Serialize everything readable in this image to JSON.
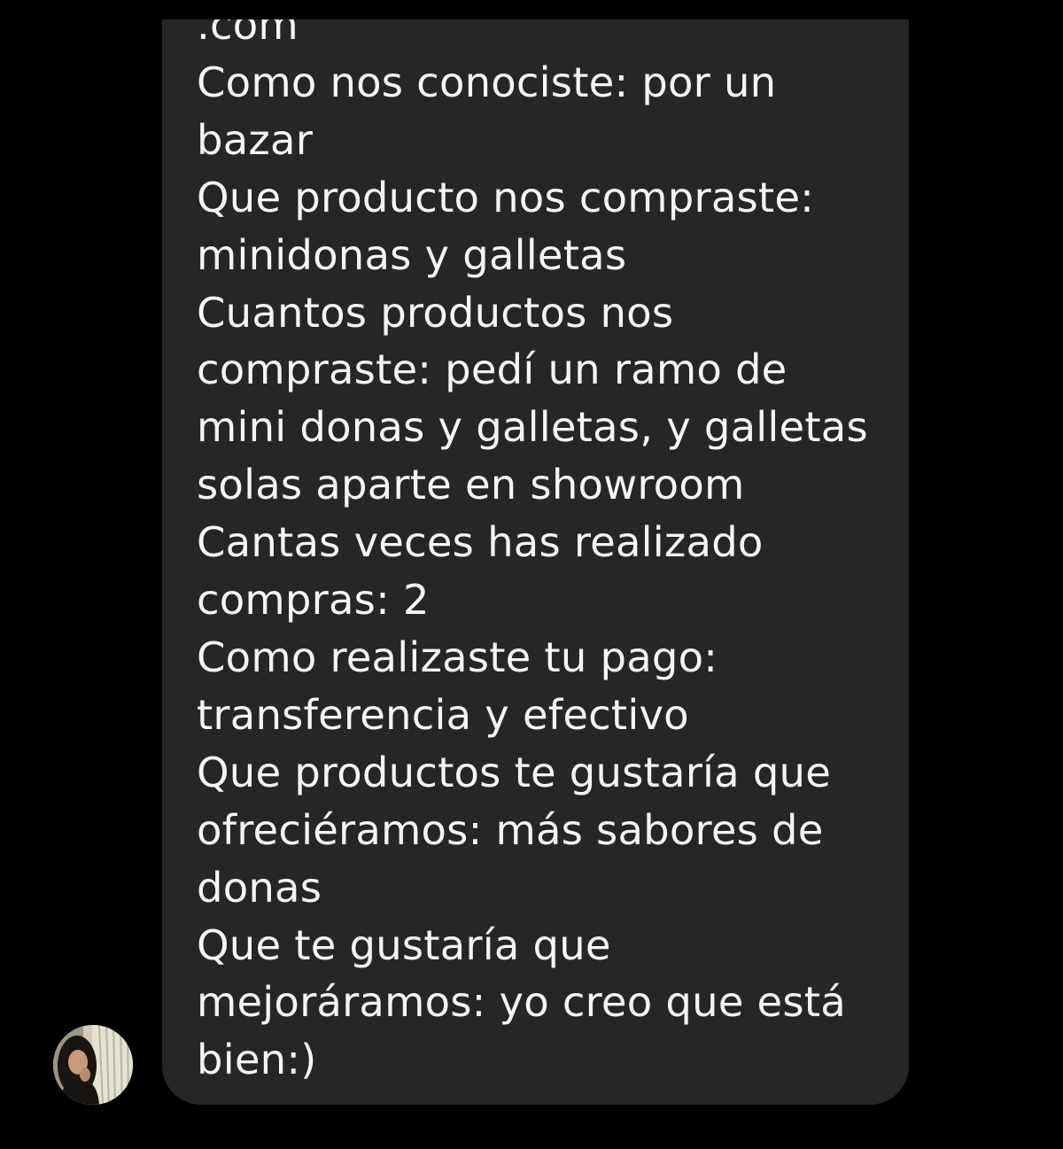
{
  "message": {
    "lines": [
      ".com",
      "Como nos conociste: por un",
      "bazar",
      "Que producto nos compraste:",
      "minidonas y galletas",
      "Cuantos productos nos",
      "compraste: pedí un ramo de",
      "mini donas y galletas, y galletas",
      "solas aparte en showroom",
      "Cantas veces has realizado",
      "compras: 2",
      "Como realizaste tu pago:",
      "transferencia y efectivo",
      "Que productos te gustaría que",
      "ofreciéramos: más sabores de",
      "donas",
      "Que te gustaría que",
      "mejoráramos: yo creo que está",
      "bien:)"
    ]
  },
  "sender": {
    "avatar_icon": "profile-photo-avatar"
  },
  "colors": {
    "background": "#000000",
    "bubble": "#262626",
    "text": "#f5f5f5"
  }
}
